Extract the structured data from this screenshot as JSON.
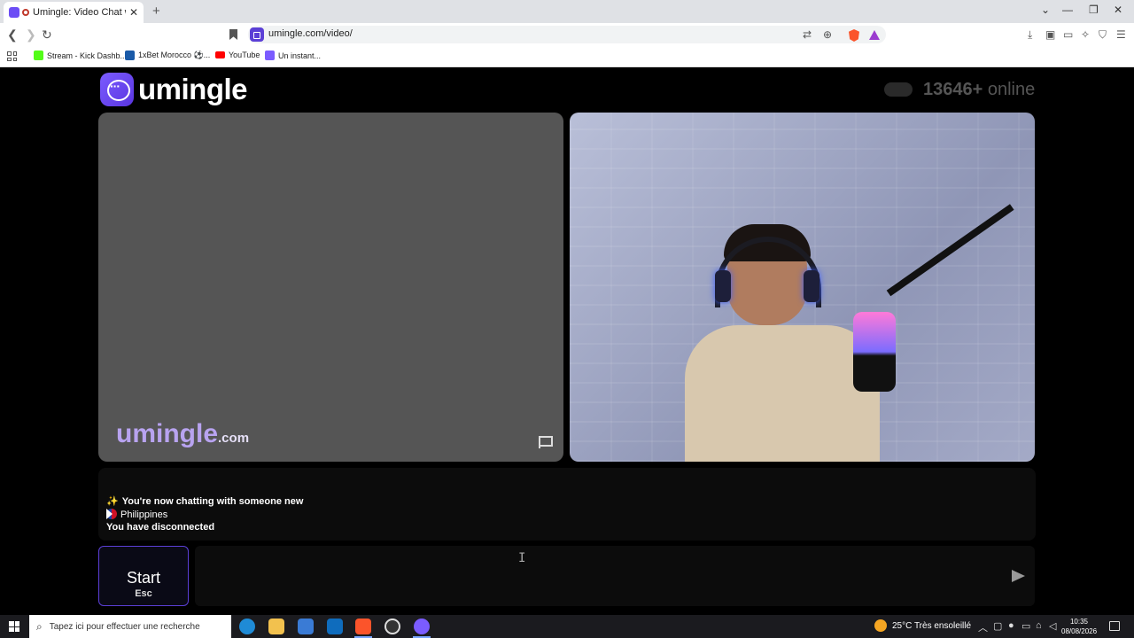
{
  "browser": {
    "tab_title": "Umingle: Video Chat with Str",
    "tab_close": "✕",
    "new_tab": "+",
    "url": "umingle.com/video/",
    "window_controls": [
      "⌄",
      "—",
      "❐",
      "✕"
    ],
    "bookmarks": [
      {
        "label": "Stream - Kick Dashb...",
        "icon": "kick-icon",
        "color": "#53fc18"
      },
      {
        "label": "1xBet Morocco ⚽...",
        "icon": "1xbet-icon",
        "color": "#1a5aa8"
      },
      {
        "label": "YouTube",
        "icon": "youtube-icon",
        "color": "#ff0000"
      },
      {
        "label": "Un instant...",
        "icon": "umingle-icon",
        "color": "#7b5cff"
      }
    ]
  },
  "site": {
    "logo_text": "umingle",
    "online_count": "13646+",
    "online_label": "online",
    "watermark_name": "umingle",
    "watermark_domain": ".com"
  },
  "chat": {
    "lines": [
      "You're now chatting with someone new",
      "Philippines",
      "You have disconnected"
    ],
    "sparkle": "✨"
  },
  "controls": {
    "start_label": "Start",
    "start_shortcut": "Esc",
    "message_placeholder": ""
  },
  "taskbar": {
    "search_placeholder": "Tapez ici pour effectuer une recherche",
    "weather": "25°C  Très ensoleillé",
    "time": "10:35",
    "date": "08/08/2026"
  },
  "colors": {
    "accent": "#6c4df5",
    "page_bg": "#000000",
    "left_video_bg": "#555555"
  }
}
